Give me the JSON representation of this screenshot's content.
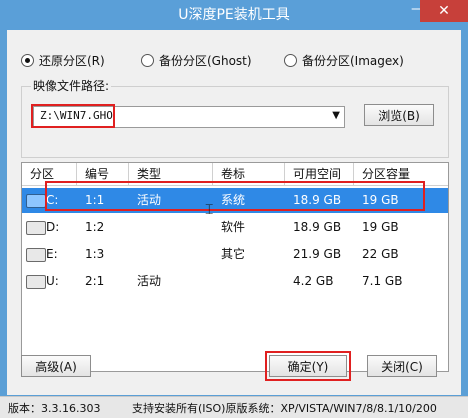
{
  "window": {
    "title": "U深度PE装机工具",
    "minimize": "—",
    "close": "✕"
  },
  "modes": [
    {
      "label": "还原分区(R)",
      "selected": true
    },
    {
      "label": "备份分区(Ghost)",
      "selected": false
    },
    {
      "label": "备份分区(Imagex)",
      "selected": false
    }
  ],
  "image_path": {
    "label": "映像文件路径:",
    "value": "Z:\\WIN7.GHO",
    "browse": "浏览(B)"
  },
  "table": {
    "headers": [
      "分区",
      "编号",
      "类型",
      "卷标",
      "可用空间",
      "分区容量"
    ],
    "rows": [
      {
        "drive": "C:",
        "num": "1:1",
        "type": "活动",
        "label": "系统",
        "free": "18.9 GB",
        "cap": "19 GB"
      },
      {
        "drive": "D:",
        "num": "1:2",
        "type": "",
        "label": "软件",
        "free": "18.9 GB",
        "cap": "19 GB"
      },
      {
        "drive": "E:",
        "num": "1:3",
        "type": "",
        "label": "其它",
        "free": "21.9 GB",
        "cap": "22 GB"
      },
      {
        "drive": "U:",
        "num": "2:1",
        "type": "活动",
        "label": "",
        "free": "4.2 GB",
        "cap": "7.1 GB"
      }
    ]
  },
  "buttons": {
    "advanced": "高级(A)",
    "ok": "确定(Y)",
    "close": "关闭(C)"
  },
  "status": {
    "version": "版本：3.3.16.303",
    "support": "支持安装所有(ISO)原版系统：XP/VISTA/WIN7/8/8.1/10/200"
  }
}
